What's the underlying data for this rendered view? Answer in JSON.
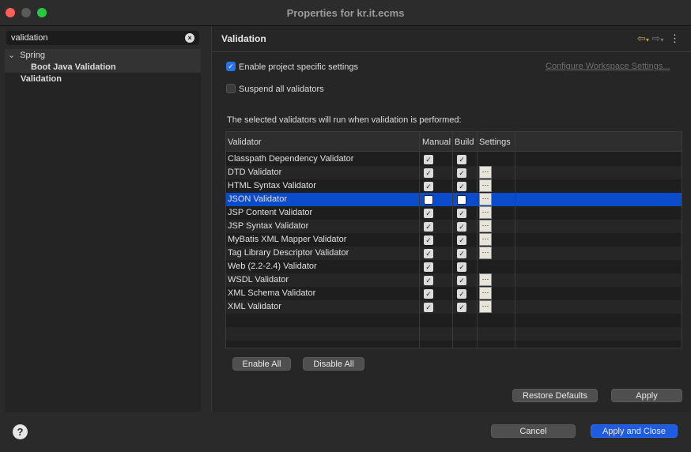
{
  "window": {
    "title": "Properties for kr.it.ecms"
  },
  "sidebar": {
    "filter_value": "validation",
    "tree": [
      {
        "label": "Spring",
        "expanded": true
      },
      {
        "label": "Boot Java Validation"
      },
      {
        "label": "Validation"
      }
    ]
  },
  "page": {
    "title": "Validation",
    "enable_project_specific": {
      "label": "Enable project specific settings",
      "checked": true
    },
    "configure_link": "Configure Workspace Settings...",
    "suspend_all": {
      "label": "Suspend all validators",
      "checked": false
    },
    "description": "The selected validators will run when validation is performed:"
  },
  "table": {
    "headers": [
      "Validator",
      "Manual",
      "Build",
      "Settings"
    ],
    "rows": [
      {
        "name": "Classpath Dependency Validator",
        "manual": true,
        "build": true,
        "settings": false
      },
      {
        "name": "DTD Validator",
        "manual": true,
        "build": true,
        "settings": true
      },
      {
        "name": "HTML Syntax Validator",
        "manual": true,
        "build": true,
        "settings": true
      },
      {
        "name": "JSON Validator",
        "manual": false,
        "build": false,
        "settings": true,
        "selected": true
      },
      {
        "name": "JSP Content Validator",
        "manual": true,
        "build": true,
        "settings": true
      },
      {
        "name": "JSP Syntax Validator",
        "manual": true,
        "build": true,
        "settings": true
      },
      {
        "name": "MyBatis XML Mapper Validator",
        "manual": true,
        "build": true,
        "settings": true
      },
      {
        "name": "Tag Library Descriptor Validator",
        "manual": true,
        "build": true,
        "settings": true
      },
      {
        "name": "Web (2.2-2.4) Validator",
        "manual": true,
        "build": true,
        "settings": false
      },
      {
        "name": "WSDL Validator",
        "manual": true,
        "build": true,
        "settings": true
      },
      {
        "name": "XML Schema Validator",
        "manual": true,
        "build": true,
        "settings": true
      },
      {
        "name": "XML Validator",
        "manual": true,
        "build": true,
        "settings": true
      }
    ]
  },
  "buttons": {
    "enable_all": "Enable All",
    "disable_all": "Disable All",
    "restore_defaults": "Restore Defaults",
    "apply": "Apply",
    "cancel": "Cancel",
    "apply_and_close": "Apply and Close"
  },
  "icons": {
    "back": "arrow-left-icon",
    "forward": "arrow-right-icon",
    "menu": "kebab-menu-icon",
    "help": "help-icon",
    "clear": "clear-icon"
  }
}
